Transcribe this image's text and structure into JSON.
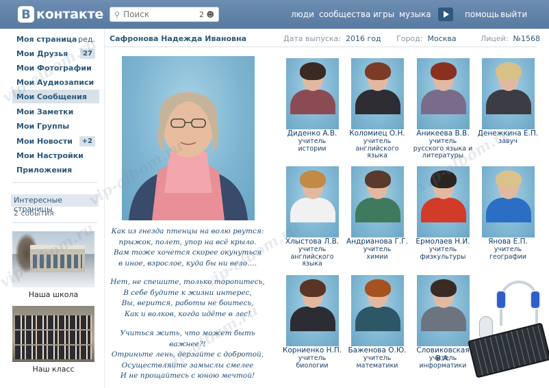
{
  "header": {
    "logo_letter": "В",
    "logo_text": "контакте",
    "search_placeholder": "Поиск",
    "search_count": "2",
    "nav": [
      "люди",
      "сообщества",
      "игры",
      "музыка",
      "помощь",
      "выйти"
    ]
  },
  "menu": {
    "items": [
      {
        "label": "Моя страница",
        "extra": "ред."
      },
      {
        "label": "Мои Друзья",
        "badge": "27"
      },
      {
        "label": "Мои Фотографии"
      },
      {
        "label": "Мои Аудиозаписи"
      },
      {
        "label": "Мои Сообщения",
        "active": true
      },
      {
        "label": "Мои Заметки"
      },
      {
        "label": "Мои Группы"
      },
      {
        "label": "Мои Новости",
        "badge": "+2"
      },
      {
        "label": "Мои Настройки"
      },
      {
        "label": "Приложения"
      }
    ],
    "interest_label": "Интересные страницы",
    "events_label": "2 события",
    "school_caption": "Наша школа",
    "class_caption": "Наш класс"
  },
  "profile": {
    "name": "Сафронова Надежда Ивановна",
    "grad_label": "Дата выпуска:",
    "grad_value": "2016 год",
    "city_label": "Город:",
    "city_value": "Москва",
    "school_label": "Лицей:",
    "school_value": "№1568"
  },
  "poem": [
    "Как из гнезда птенцы на волю рвутся:",
    "прыжок, полет, упор на всё крыло.",
    "Вам тоже хочется скорее окунуться",
    "в иное, взрослое, куда бы ни вело….",
    "",
    "Нет, не спешите, только торопитесь,",
    "В себе будите к жизни интерес,",
    "Вы, верится, работы не боитесь,",
    "Как и волков, когда идёте в лес!",
    "",
    "Учиться жить, что может быть важнее?!",
    "Отриньте лень, дерзайте с добротой,",
    "Осуществляйте замыслы смелее",
    "И не прощайтесь с юною мечтой!"
  ],
  "teachers": [
    {
      "name": "Диденко А.В.",
      "role": [
        "учитель",
        "истории"
      ]
    },
    {
      "name": "Коломиец О.Н.",
      "role": [
        "учитель",
        "английского",
        "языка"
      ]
    },
    {
      "name": "Аникеева В.В.",
      "role": [
        "учитель",
        "русского языка и",
        "литературы"
      ]
    },
    {
      "name": "Денежкина Е.П.",
      "role": [
        "завуч"
      ]
    },
    {
      "name": "Хлыстова Л.В.",
      "role": [
        "учитель",
        "английского",
        "языка"
      ]
    },
    {
      "name": "Андрианова Г.Г.",
      "role": [
        "учитель",
        "химии"
      ]
    },
    {
      "name": "Ермолаев Н.И.",
      "role": [
        "учитель",
        "физкультуры"
      ]
    },
    {
      "name": "Янова Е.П.",
      "role": [
        "учитель",
        "географии"
      ]
    },
    {
      "name": "Корниенко Н.П.",
      "role": [
        "учитель",
        "биологии"
      ]
    },
    {
      "name": "Баженова О.Ю.",
      "role": [
        "учитель",
        "математики"
      ]
    },
    {
      "name": "Словиковская В.А.",
      "role": [
        "учитель",
        "информатики"
      ]
    }
  ],
  "watermark": "vip-albom.ru",
  "colors": {
    "header": "#5f7fa4",
    "link": "#2b587a",
    "photo_bg": "#7cb3d0"
  }
}
